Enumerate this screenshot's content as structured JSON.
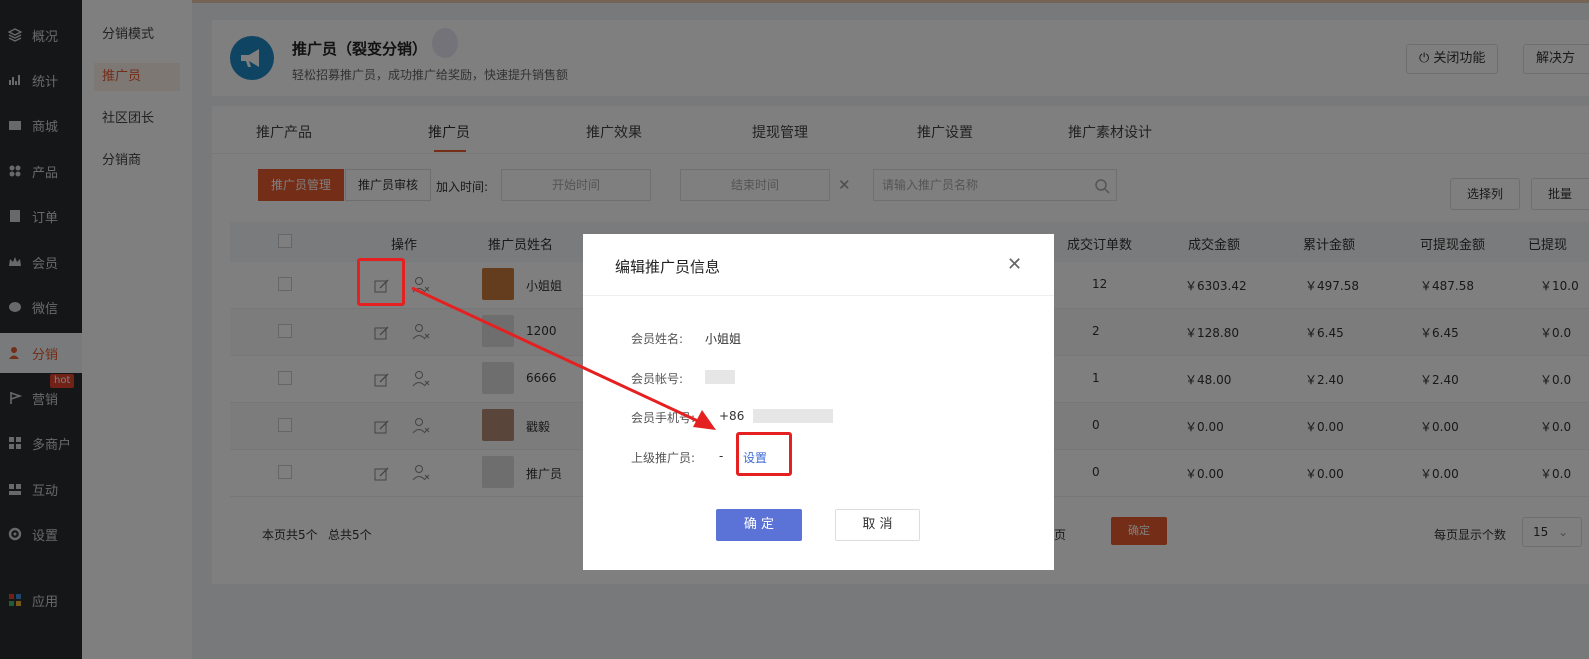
{
  "nav": {
    "items": [
      {
        "label": "概况",
        "icon": "layers-icon"
      },
      {
        "label": "统计",
        "icon": "stats-icon"
      },
      {
        "label": "商城",
        "icon": "store-icon"
      },
      {
        "label": "产品",
        "icon": "grid-icon"
      },
      {
        "label": "订单",
        "icon": "order-icon"
      },
      {
        "label": "会员",
        "icon": "crown-icon"
      },
      {
        "label": "微信",
        "icon": "wechat-icon"
      },
      {
        "label": "分销",
        "icon": "user-icon",
        "active": true
      },
      {
        "label": "营销",
        "icon": "flag-icon"
      },
      {
        "label": "多商户",
        "icon": "shop-icon"
      },
      {
        "label": "互动",
        "icon": "interact-icon"
      },
      {
        "label": "设置",
        "icon": "gear-icon"
      },
      {
        "label": "应用",
        "icon": "apps-icon"
      }
    ],
    "hot_badge": "hot"
  },
  "subnav": {
    "items": [
      {
        "label": "分销模式"
      },
      {
        "label": "推广员",
        "active": true
      },
      {
        "label": "社区团长"
      },
      {
        "label": "分销商"
      }
    ]
  },
  "header": {
    "title": "推广员（裂变分销）",
    "subtitle": "轻松招募推广员，成功推广给奖励，快速提升销售额",
    "close_feature": "关闭功能",
    "solution": "解决方"
  },
  "tabs": [
    "推广产品",
    "推广员",
    "推广效果",
    "提现管理",
    "推广设置",
    "推广素材设计"
  ],
  "toolbar": {
    "seg_manage": "推广员管理",
    "seg_audit": "推广员审核",
    "join_time_label": "加入时间:",
    "start_time": "开始时间",
    "end_time": "结束时间",
    "search_placeholder": "请输入推广员名称",
    "select_columns": "选择列",
    "batch": "批量"
  },
  "table": {
    "headers": [
      "操作",
      "推广员姓名",
      "成交订单数",
      "成交金额",
      "累计金额",
      "可提现金额",
      "已提现"
    ],
    "rows": [
      {
        "name": "小姐姐",
        "orders": "12",
        "amount": "￥6303.42",
        "total": "￥497.58",
        "withdrawable": "￥487.58",
        "withdrawn": "￥10.0"
      },
      {
        "name": "1200",
        "orders": "2",
        "amount": "￥128.80",
        "total": "￥6.45",
        "withdrawable": "￥6.45",
        "withdrawn": "￥0.0"
      },
      {
        "name": "6666",
        "orders": "1",
        "amount": "￥48.00",
        "total": "￥2.40",
        "withdrawable": "￥2.40",
        "withdrawn": "￥0.0"
      },
      {
        "name": "戳毅",
        "orders": "0",
        "amount": "￥0.00",
        "total": "￥0.00",
        "withdrawable": "￥0.00",
        "withdrawn": "￥0.0"
      },
      {
        "name": "推广员",
        "orders": "0",
        "amount": "￥0.00",
        "total": "￥0.00",
        "withdrawable": "￥0.00",
        "withdrawn": "￥0.0"
      }
    ]
  },
  "footer": {
    "summary_page": "本页共5个",
    "summary_total": "总共5个",
    "page_suffix": "页",
    "confirm": "确定",
    "per_page_label": "每页显示个数",
    "per_page_value": "15"
  },
  "modal": {
    "title": "编辑推广员信息",
    "member_name_label": "会员姓名:",
    "member_name": "小姐姐",
    "member_account_label": "会员帐号:",
    "member_phone_label": "会员手机号:",
    "member_phone_prefix": "+86",
    "superior_label": "上级推广员:",
    "superior_value": "-",
    "set_link": "设置",
    "ok": "确 定",
    "cancel": "取 消"
  },
  "colors": {
    "accent": "#e85a2d",
    "primary_button": "#5b72d6",
    "annotation": "#e52020"
  }
}
